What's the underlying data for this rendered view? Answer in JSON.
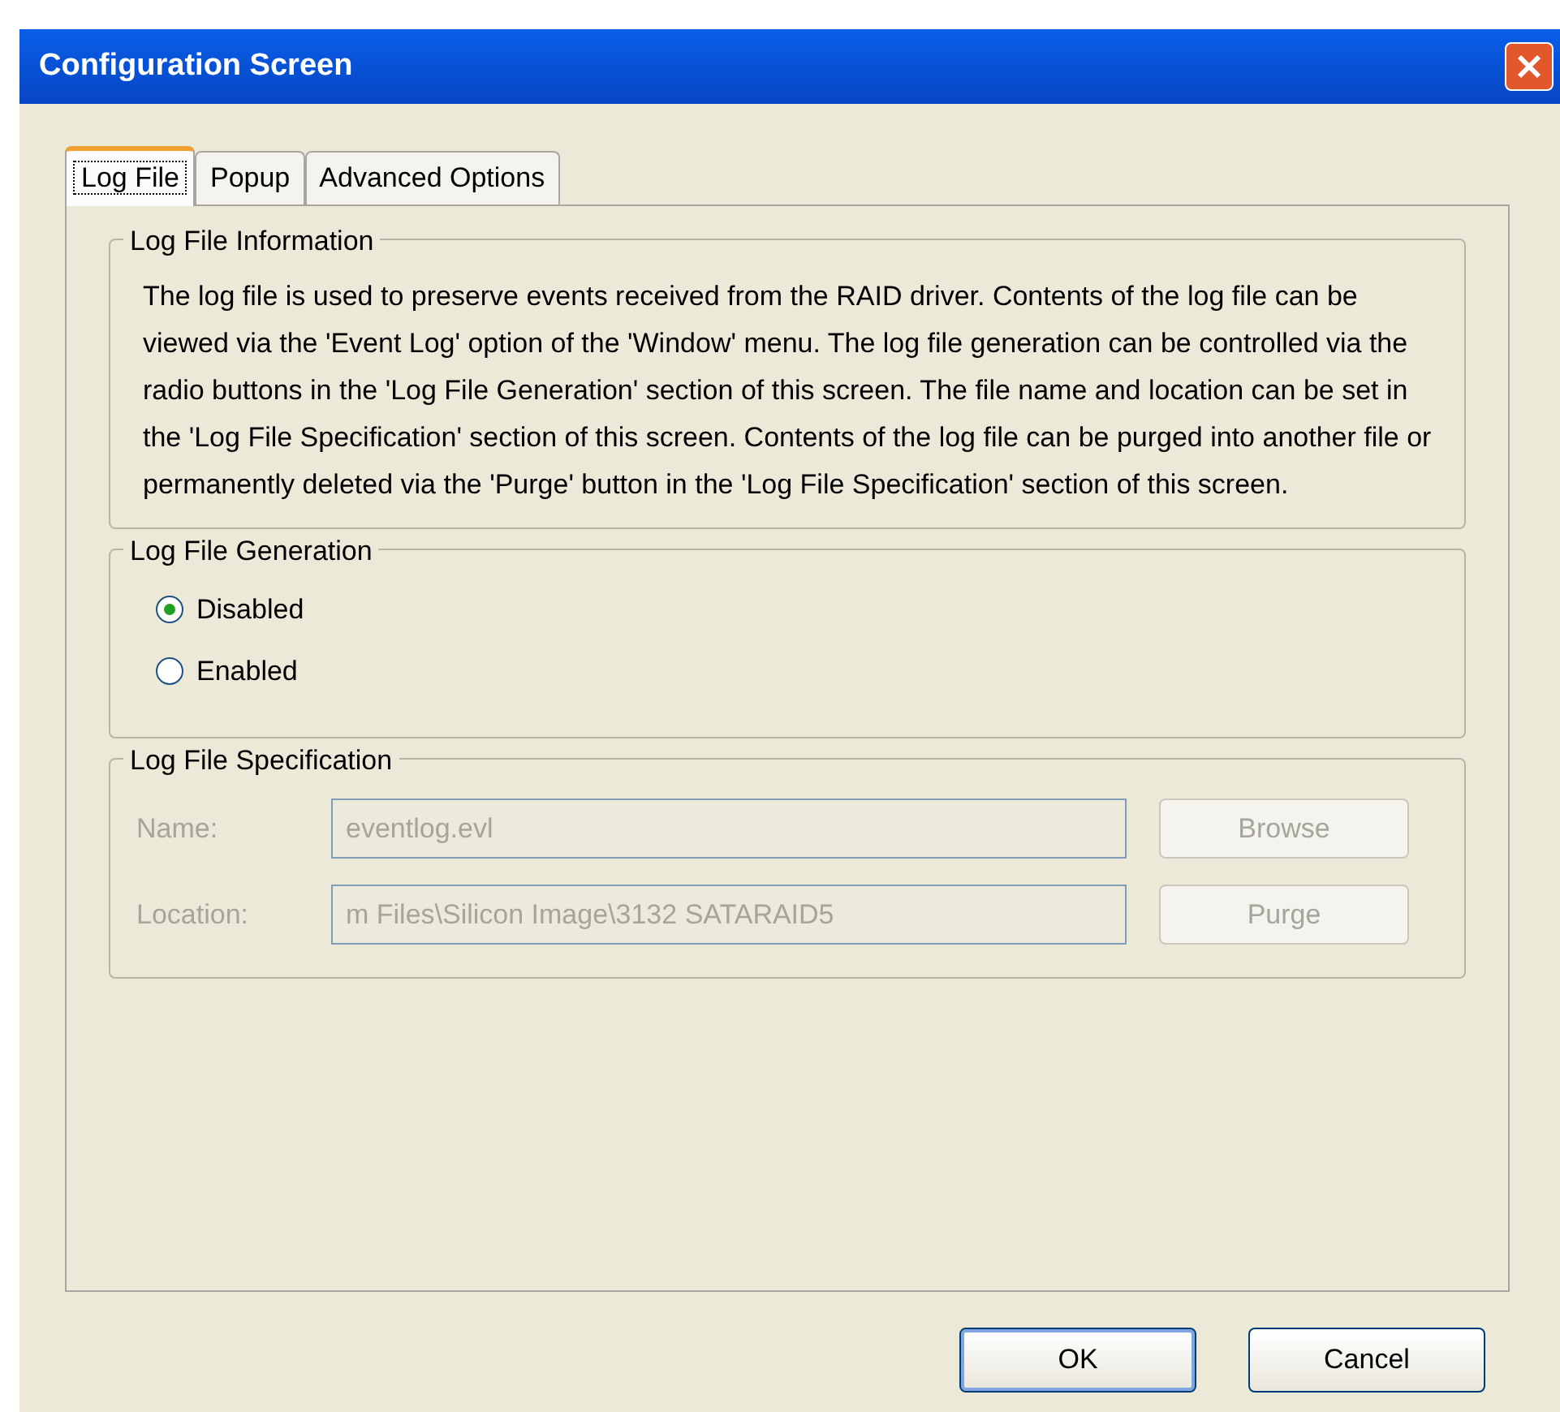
{
  "window": {
    "title": "Configuration Screen"
  },
  "tabs": [
    {
      "label": "Log File",
      "selected": true
    },
    {
      "label": "Popup",
      "selected": false
    },
    {
      "label": "Advanced Options",
      "selected": false
    }
  ],
  "info": {
    "title": "Log File Information",
    "text": "The log file is used to preserve events received from the RAID driver. Contents of the log file can be viewed via the 'Event Log' option of the 'Window' menu. The log file generation can be controlled via the radio buttons in the 'Log File Generation' section of this screen. The file name and location can be set  in  the  'Log File Specification' section of this screen.  Contents of the log file can be purged into another  file  or  permanently deleted via the 'Purge' button in the 'Log File Specification' section of this screen."
  },
  "generation": {
    "title": "Log File Generation",
    "options": [
      {
        "label": "Disabled",
        "selected": true
      },
      {
        "label": "Enabled",
        "selected": false
      }
    ]
  },
  "specification": {
    "title": "Log File Specification",
    "disabled": true,
    "rows": [
      {
        "label": "Name:",
        "value": "eventlog.evl",
        "button": "Browse"
      },
      {
        "label": "Location:",
        "value": "m Files\\Silicon Image\\3132 SATARAID5",
        "button": "Purge"
      }
    ]
  },
  "buttons": [
    "OK",
    "Cancel"
  ]
}
